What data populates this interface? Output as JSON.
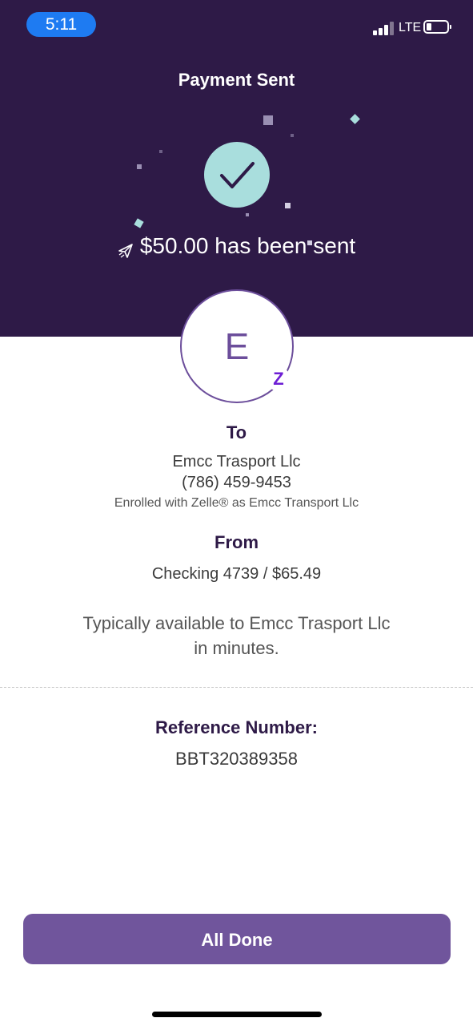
{
  "status_bar": {
    "time": "5:11",
    "network": "LTE"
  },
  "header": {
    "title": "Payment Sent",
    "sent_message": "$50.00 has been sent",
    "colors": {
      "background": "#2e1a47",
      "check_circle": "#a9dedd"
    },
    "icons": [
      "check-icon",
      "paper-plane-icon"
    ]
  },
  "recipient": {
    "avatar_initial": "E",
    "badge_icon": "zelle-icon",
    "badge_glyph": "Z"
  },
  "to": {
    "heading": "To",
    "name": "Emcc Trasport Llc",
    "phone": "(786) 459-9453",
    "enrolled_note": "Enrolled with Zelle® as Emcc Transport Llc"
  },
  "from": {
    "heading": "From",
    "account": "Checking 4739 / $65.49"
  },
  "availability": {
    "line1": "Typically available to Emcc Trasport Llc",
    "line2": "in minutes."
  },
  "reference": {
    "heading": "Reference Number:",
    "number": "BBT320389358"
  },
  "actions": {
    "done_label": "All Done",
    "button_color": "#70559c"
  }
}
